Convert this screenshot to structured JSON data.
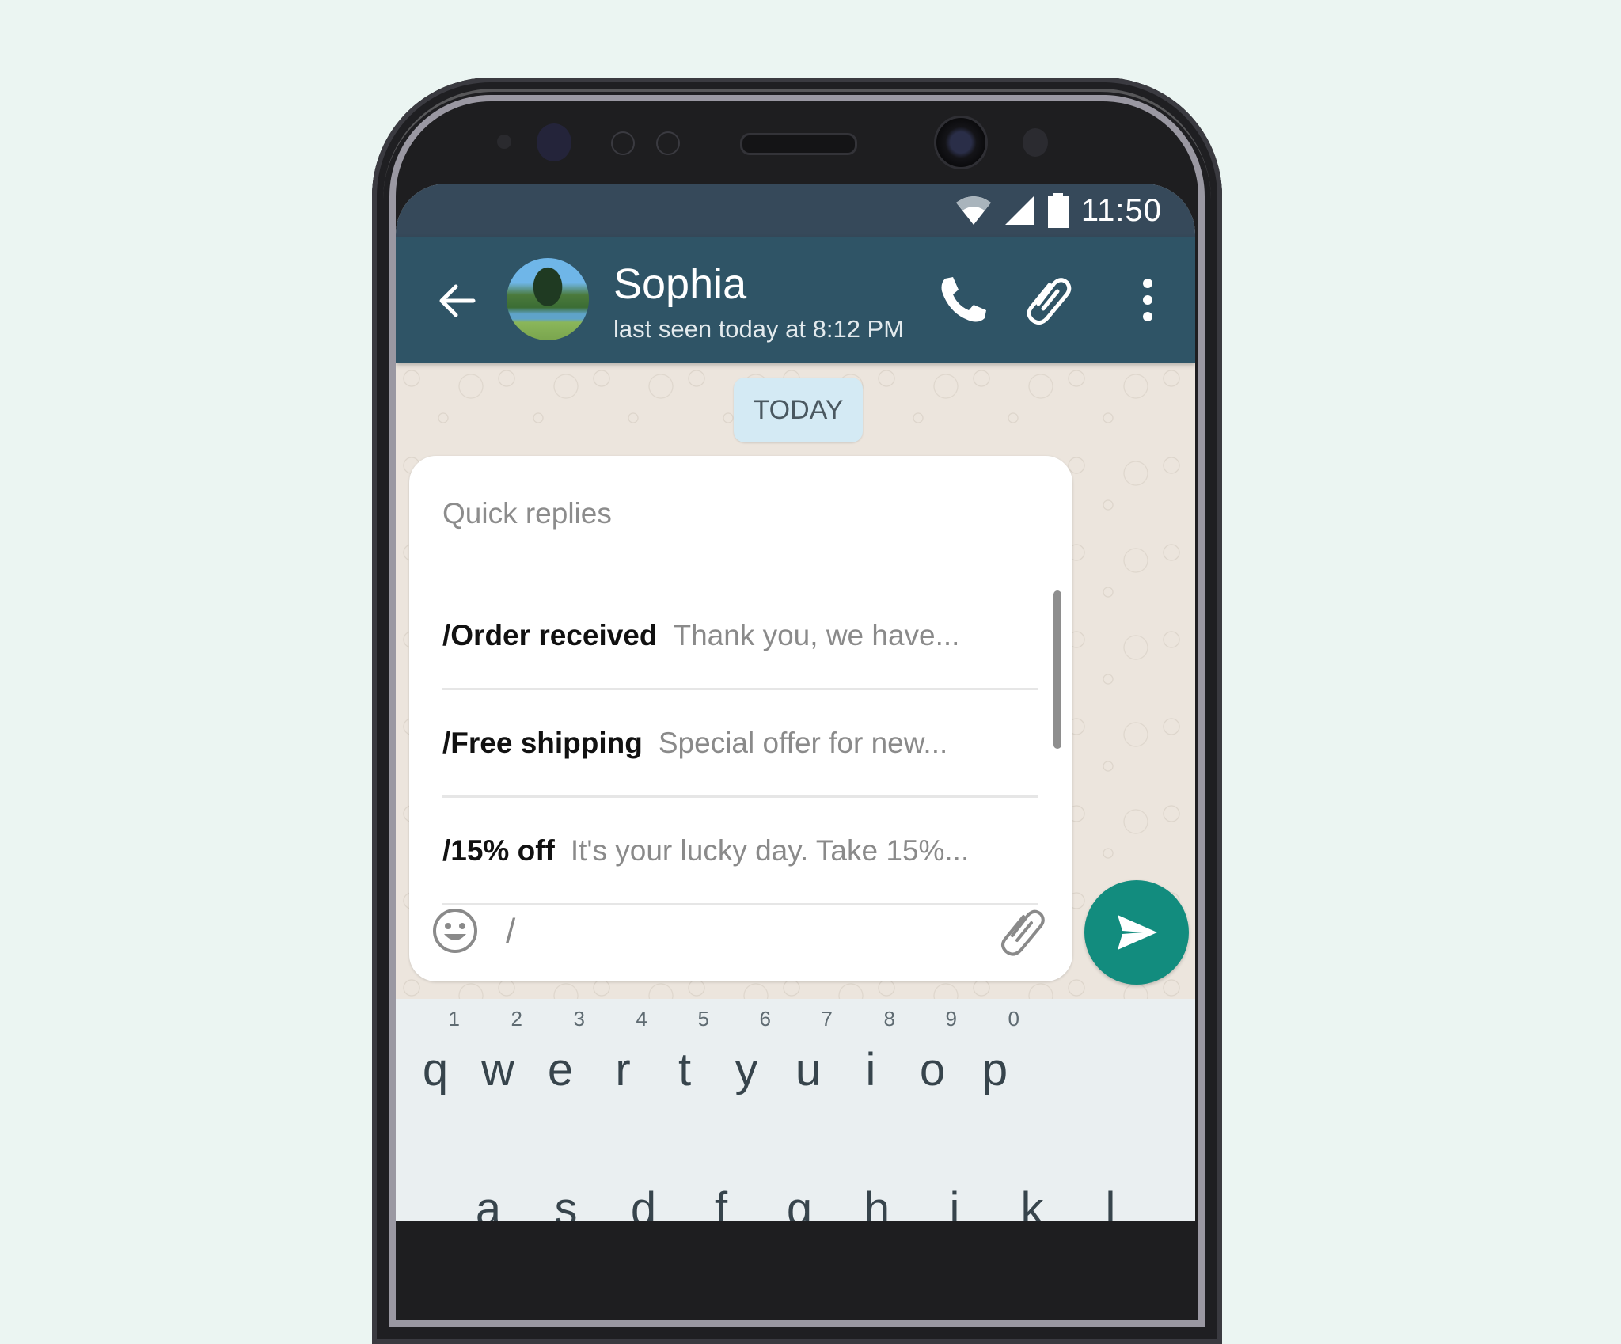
{
  "status_bar": {
    "time": "11:50",
    "icons": [
      "wifi-icon",
      "signal-icon",
      "battery-icon"
    ]
  },
  "header": {
    "contact_name": "Sophia",
    "last_seen": "last seen today at 8:12 PM",
    "icons": [
      "back-arrow-icon",
      "avatar",
      "phone-icon",
      "paperclip-icon",
      "more-vertical-icon"
    ]
  },
  "chat": {
    "date_label": "TODAY"
  },
  "quick_replies": {
    "title": "Quick replies",
    "items": [
      {
        "shortcut": "/Order received",
        "preview": "Thank you, we have..."
      },
      {
        "shortcut": "/Free shipping",
        "preview": "Special offer for new..."
      },
      {
        "shortcut": "/15% off",
        "preview": "It's your lucky day. Take 15%..."
      }
    ]
  },
  "composer": {
    "value": "/",
    "icons": [
      "emoji-icon",
      "paperclip-icon",
      "send-icon"
    ]
  },
  "keyboard": {
    "row1": [
      {
        "key": "q",
        "hint": "1"
      },
      {
        "key": "w",
        "hint": "2"
      },
      {
        "key": "e",
        "hint": "3"
      },
      {
        "key": "r",
        "hint": "4"
      },
      {
        "key": "t",
        "hint": "5"
      },
      {
        "key": "y",
        "hint": "6"
      },
      {
        "key": "u",
        "hint": "7"
      },
      {
        "key": "i",
        "hint": "8"
      },
      {
        "key": "o",
        "hint": "9"
      },
      {
        "key": "p",
        "hint": "0"
      }
    ],
    "row2": [
      "a",
      "s",
      "d",
      "f",
      "g",
      "h",
      "j",
      "k",
      "l"
    ]
  },
  "colors": {
    "status_bar": "#36495A",
    "app_bar": "#2F5466",
    "send_button": "#128C7E",
    "chat_background": "#ECE5DD",
    "date_chip": "#D4EAF4",
    "page_background": "#EBF5F2"
  }
}
